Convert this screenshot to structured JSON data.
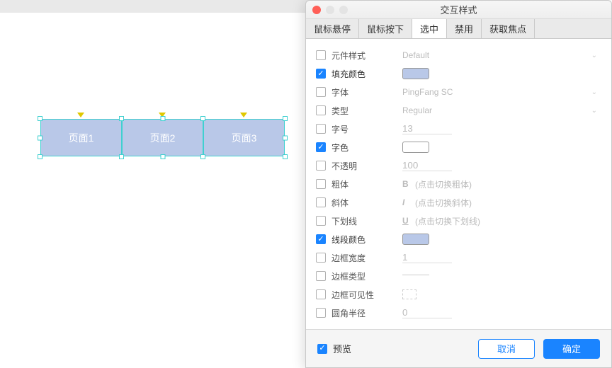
{
  "canvas": {
    "cells": [
      "页面1",
      "页面2",
      "页面3"
    ]
  },
  "dialog": {
    "title": "交互样式",
    "tabs": [
      "鼠标悬停",
      "鼠标按下",
      "选中",
      "禁用",
      "获取焦点"
    ],
    "activeTabIndex": 2,
    "rows": {
      "componentStyle": {
        "label": "元件样式",
        "value": "Default",
        "checked": false
      },
      "fillColor": {
        "label": "填充颜色",
        "swatch": "#b9c8e8",
        "checked": true
      },
      "font": {
        "label": "字体",
        "value": "PingFang SC",
        "checked": false
      },
      "type": {
        "label": "类型",
        "value": "Regular",
        "checked": false
      },
      "fontSize": {
        "label": "字号",
        "value": "13",
        "checked": false
      },
      "textColor": {
        "label": "字色",
        "swatch": "#ffffff",
        "checked": true
      },
      "opacity": {
        "label": "不透明",
        "value": "100",
        "checked": false
      },
      "bold": {
        "label": "粗体",
        "icon": "B",
        "hint": "(点击切换粗体)",
        "checked": false
      },
      "italic": {
        "label": "斜体",
        "icon": "I",
        "hint": "(点击切换斜体)",
        "checked": false
      },
      "underline": {
        "label": "下划线",
        "icon": "U",
        "hint": "(点击切换下划线)",
        "checked": false
      },
      "lineColor": {
        "label": "线段颜色",
        "swatch": "#b9c8e8",
        "checked": true
      },
      "borderWidth": {
        "label": "边框宽度",
        "value": "1",
        "checked": false
      },
      "borderType": {
        "label": "边框类型",
        "checked": false
      },
      "borderVis": {
        "label": "边框可见性",
        "checked": false
      },
      "cornerRadius": {
        "label": "圆角半径",
        "value": "0",
        "checked": false
      }
    },
    "footer": {
      "previewLabel": "预览",
      "cancel": "取消",
      "ok": "确定"
    }
  }
}
